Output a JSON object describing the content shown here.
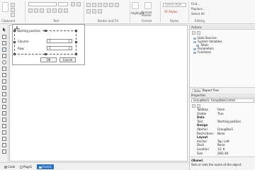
{
  "ribbon": {
    "groups": [
      "Clipboard",
      "Text",
      "Border and Fill",
      "Format",
      "Styles",
      "Editing"
    ],
    "styles_placeholder": "Select style",
    "buttons": {
      "highlight": "Highlight",
      "format_painter": "Format Painter",
      "styles": "AF Styles"
    },
    "editing": {
      "find": "Find...",
      "replace": "Replace...",
      "select_all": "Select All"
    }
  },
  "dialog": {
    "group_title": "Starting position",
    "column_label": "Column:",
    "column_value": "1",
    "row_label": "Row:",
    "row_value": "1",
    "ok_label": "OK",
    "cancel_label": "Cancel"
  },
  "bottom_tabs": {
    "code": "Code",
    "page1": "Page1",
    "form1": "Form1"
  },
  "actions_panel": {
    "title": "Actions",
    "tree": [
      "Data Sources",
      "System Variables",
      "Totals",
      "Parameters",
      "Functions"
    ],
    "tabs": [
      "Data",
      "Report Tree"
    ]
  },
  "properties_panel": {
    "title": "Properties",
    "selected": "GroupBox1: GroupBoxControl",
    "rows": [
      {
        "name": "TabStop",
        "value": "False",
        "category": false
      },
      {
        "name": "Visible",
        "value": "True",
        "category": false
      },
      {
        "name": "Data",
        "value": "",
        "category": true
      },
      {
        "name": "Text",
        "value": "Starting position",
        "category": false
      },
      {
        "name": "Design",
        "value": "",
        "category": true
      },
      {
        "name": "(Name)",
        "value": "GroupBox1",
        "category": false
      },
      {
        "name": "Restrictions",
        "value": "None",
        "category": false
      },
      {
        "name": "Layout",
        "value": "",
        "category": true
      },
      {
        "name": "Anchor",
        "value": "Top, Left",
        "category": false
      },
      {
        "name": "Dock",
        "value": "None",
        "category": false
      },
      {
        "name": "Location",
        "value": "12; 6",
        "category": false
      },
      {
        "name": "Size",
        "value": "268; 84",
        "category": false
      }
    ],
    "description_title": "(Name)",
    "description_text": "Sets or sets the name of the object."
  }
}
